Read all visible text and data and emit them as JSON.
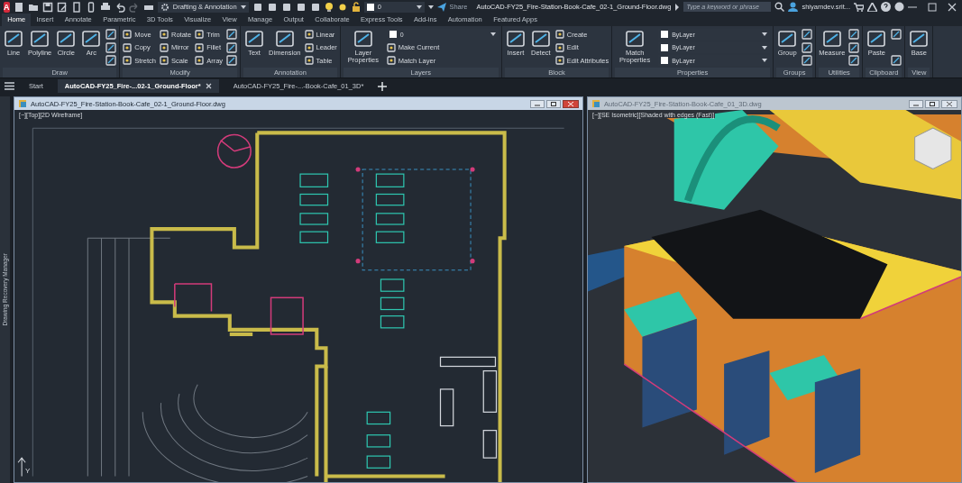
{
  "title_bar": {
    "logo": "A",
    "workspace": "Drafting & Annotation",
    "layer": "0",
    "share": "Share",
    "title": "AutoCAD-FY25_Fire-Station-Book-Cafe_02-1_Ground-Floor.dwg",
    "search": {
      "placeholder": "Type a keyword or phrase"
    },
    "user": "shiyamdev.srit..."
  },
  "ribbon_tabs": [
    {
      "label": "Home",
      "selected": true
    },
    {
      "label": "Insert",
      "selected": false
    },
    {
      "label": "Annotate",
      "selected": false
    },
    {
      "label": "Parametric",
      "selected": false
    },
    {
      "label": "3D Tools",
      "selected": false
    },
    {
      "label": "Visualize",
      "selected": false
    },
    {
      "label": "View",
      "selected": false
    },
    {
      "label": "Manage",
      "selected": false
    },
    {
      "label": "Output",
      "selected": false
    },
    {
      "label": "Collaborate",
      "selected": false
    },
    {
      "label": "Express Tools",
      "selected": false
    },
    {
      "label": "Add-ins",
      "selected": false
    },
    {
      "label": "Automation",
      "selected": false
    },
    {
      "label": "Featured Apps",
      "selected": false
    }
  ],
  "ribbon_panels": [
    {
      "title": "Draw",
      "columns": [
        [
          {
            "kind": "large",
            "label": "Line"
          }
        ],
        [
          {
            "kind": "large",
            "label": "Polyline"
          }
        ],
        [
          {
            "kind": "large",
            "label": "Circle"
          }
        ],
        [
          {
            "kind": "large",
            "label": "Arc"
          }
        ],
        [
          {
            "kind": "icon"
          },
          {
            "kind": "icon"
          },
          {
            "kind": "icon"
          }
        ]
      ]
    },
    {
      "title": "Modify",
      "columns": [
        [
          {
            "kind": "small",
            "label": "Move"
          },
          {
            "kind": "small",
            "label": "Copy"
          },
          {
            "kind": "small",
            "label": "Stretch"
          }
        ],
        [
          {
            "kind": "small",
            "label": "Rotate"
          },
          {
            "kind": "small",
            "label": "Mirror"
          },
          {
            "kind": "small",
            "label": "Scale"
          }
        ],
        [
          {
            "kind": "small",
            "label": "Trim"
          },
          {
            "kind": "small",
            "label": "Fillet"
          },
          {
            "kind": "small",
            "label": "Array"
          }
        ],
        [
          {
            "kind": "icon"
          },
          {
            "kind": "icon"
          },
          {
            "kind": "icon"
          }
        ]
      ]
    },
    {
      "title": "Annotation",
      "columns": [
        [
          {
            "kind": "large",
            "label": "Text"
          }
        ],
        [
          {
            "kind": "large",
            "label": "Dimension"
          }
        ],
        [
          {
            "kind": "small",
            "label": "Linear"
          },
          {
            "kind": "small",
            "label": "Leader"
          },
          {
            "kind": "small",
            "label": "Table"
          }
        ]
      ]
    },
    {
      "title": "Layers",
      "columns": [
        [
          {
            "kind": "large",
            "label": "Layer Properties"
          }
        ],
        [
          {
            "kind": "dropdown",
            "label": "0"
          },
          {
            "kind": "small",
            "label": "Make Current"
          },
          {
            "kind": "small",
            "label": "Match Layer"
          }
        ]
      ]
    },
    {
      "title": "Block",
      "columns": [
        [
          {
            "kind": "large",
            "label": "Insert"
          }
        ],
        [
          {
            "kind": "large",
            "label": "Detect"
          }
        ],
        [
          {
            "kind": "small",
            "label": "Create"
          },
          {
            "kind": "small",
            "label": "Edit"
          },
          {
            "kind": "small",
            "label": "Edit Attributes"
          }
        ]
      ]
    },
    {
      "title": "Properties",
      "columns": [
        [
          {
            "kind": "large",
            "label": "Match Properties"
          }
        ],
        [
          {
            "kind": "dropdown",
            "label": "ByLayer"
          },
          {
            "kind": "dropdown",
            "label": "ByLayer"
          },
          {
            "kind": "dropdown",
            "label": "ByLayer"
          }
        ]
      ]
    },
    {
      "title": "Groups",
      "columns": [
        [
          {
            "kind": "large",
            "label": "Group"
          }
        ],
        [
          {
            "kind": "icon"
          },
          {
            "kind": "icon"
          },
          {
            "kind": "icon"
          }
        ]
      ]
    },
    {
      "title": "Utilities",
      "columns": [
        [
          {
            "kind": "large",
            "label": "Measure"
          }
        ],
        [
          {
            "kind": "icon"
          },
          {
            "kind": "icon"
          },
          {
            "kind": "icon"
          }
        ]
      ]
    },
    {
      "title": "Clipboard",
      "columns": [
        [
          {
            "kind": "large",
            "label": "Paste"
          }
        ],
        [
          {
            "kind": "icon"
          },
          {
            "kind": "icon"
          }
        ]
      ]
    },
    {
      "title": "View",
      "columns": [
        [
          {
            "kind": "large",
            "label": "Base"
          }
        ]
      ]
    }
  ],
  "document_tabs": [
    {
      "label": "Start",
      "selected": false
    },
    {
      "label": "AutoCAD-FY25_Fire-...02-1_Ground-Floor*",
      "selected": true
    },
    {
      "label": "AutoCAD-FY25_Fire-...-Book-Cafe_01_3D*",
      "selected": false
    }
  ],
  "side_panel": {
    "label": "Drawing Recovery Manager"
  },
  "windows": [
    {
      "title": "AutoCAD-FY25_Fire-Station-Book-Cafe_02-1_Ground-Floor.dwg",
      "viewport_label": "[−][Top][2D Wireframe]",
      "kind": "plan",
      "active": true,
      "ucs_label": "Y"
    },
    {
      "title": "AutoCAD-FY25_Fire-Station-Book-Cafe_01_3D.dwg",
      "viewport_label": "[−][SE Isometric][Shaded with edges (Fast)]",
      "kind": "iso",
      "active": false
    }
  ]
}
